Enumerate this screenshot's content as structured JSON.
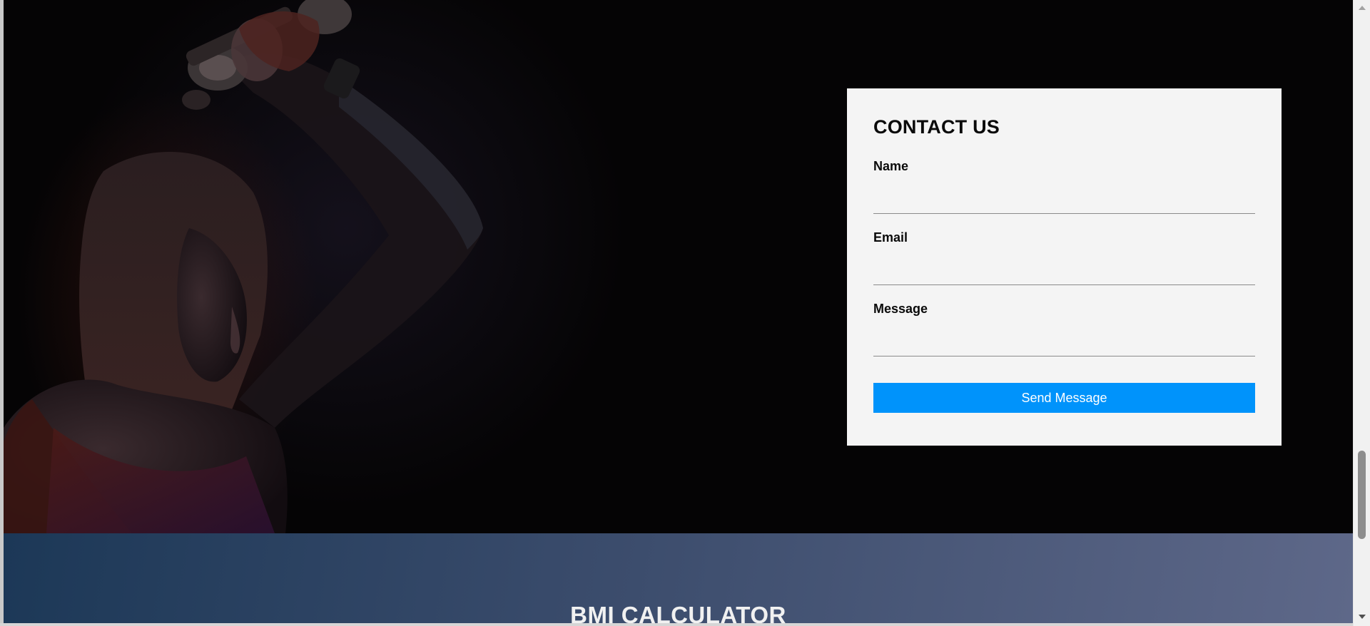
{
  "contact": {
    "title": "CONTACT US",
    "fields": [
      {
        "label": "Name",
        "value": "",
        "placeholder": ""
      },
      {
        "label": "Email",
        "value": "",
        "placeholder": ""
      },
      {
        "label": "Message",
        "value": "",
        "placeholder": ""
      }
    ],
    "submit_label": "Send Message"
  },
  "bmi": {
    "title": "BMI CALCULATOR"
  },
  "colors": {
    "accent": "#0093fb",
    "card_background": "#f4f4f4",
    "hero_background": "#050405",
    "bmi_gradient_start": "#1c3857",
    "bmi_gradient_end": "#5e6889"
  },
  "icons": {
    "scroll_up": "scroll-up-arrow-icon",
    "scroll_down": "scroll-down-arrow-icon"
  }
}
